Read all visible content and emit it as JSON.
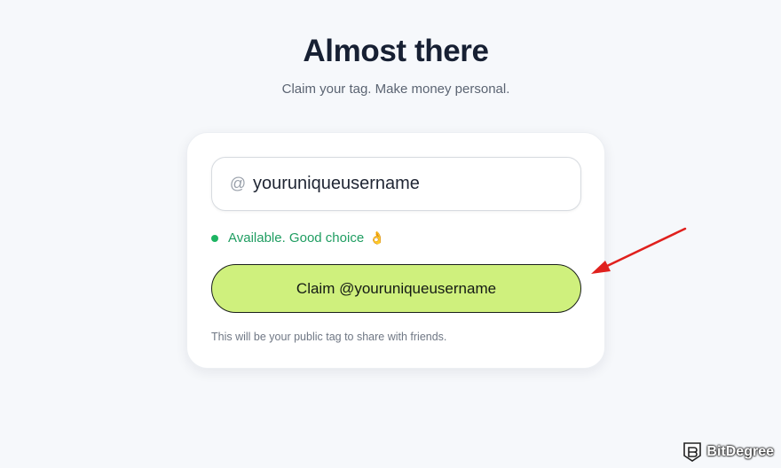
{
  "header": {
    "title": "Almost there",
    "subtitle": "Claim your tag. Make money personal."
  },
  "form": {
    "at_symbol": "@",
    "username_value": "youruniqueusername",
    "status_text": "Available. Good choice",
    "status_emoji": "👌",
    "claim_button_label": "Claim @youruniqueusername",
    "hint": "This will be your public tag to share with friends."
  },
  "watermark": {
    "text": "BitDegree"
  },
  "icons": {
    "at": "at-icon",
    "status": "status-dot-icon",
    "annotation": "arrow-icon",
    "logo": "bitdegree-logo-icon"
  },
  "colors": {
    "button": "#cff07d",
    "status": "#1f9d61",
    "arrow": "#e0201d"
  }
}
